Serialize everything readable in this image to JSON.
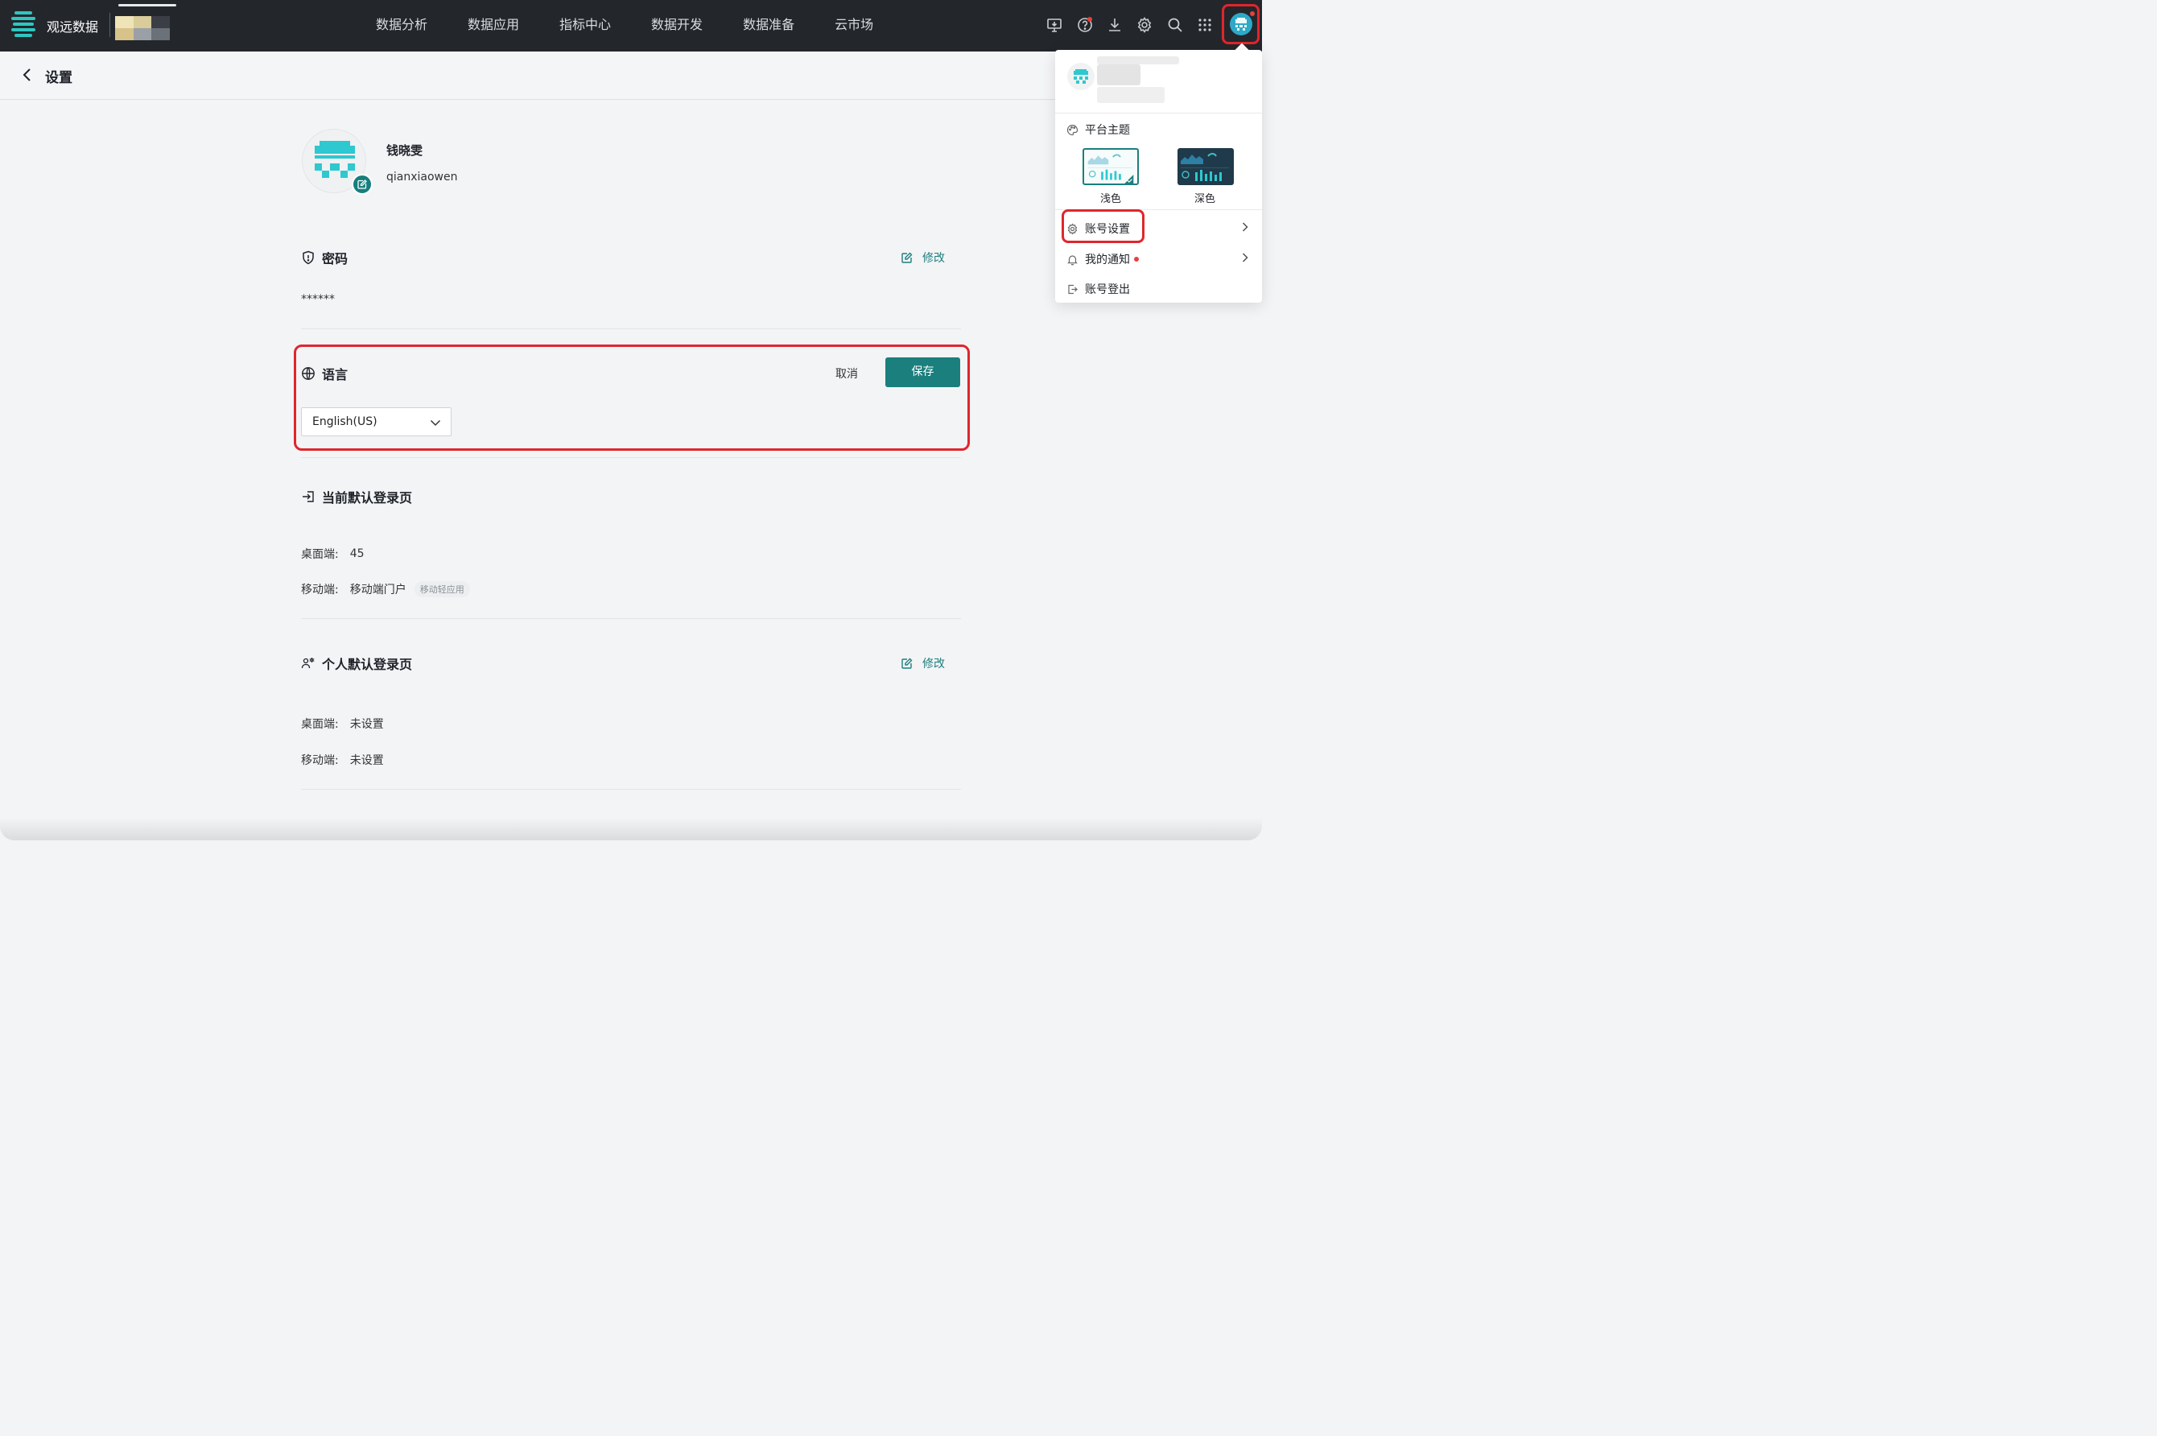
{
  "app": {
    "brand": "观远数据"
  },
  "nav": {
    "items": [
      "数据分析",
      "数据应用",
      "指标中心",
      "数据开发",
      "数据准备",
      "云市场"
    ]
  },
  "toolbar": {
    "icons": [
      "desktop-download-icon",
      "help-icon",
      "download-icon",
      "gear-icon",
      "search-icon",
      "apps-grid-icon"
    ]
  },
  "colors": {
    "topbar": "#23272c",
    "accent": "#1b7f7d",
    "highlight": "#e0262c",
    "badge": "#e8403c",
    "logo": "#2fc6c2"
  },
  "page": {
    "title": "设置"
  },
  "profile": {
    "name": "钱晓雯",
    "account": "qianxiaowen"
  },
  "password": {
    "title": "密码",
    "edit_label": "修改",
    "value": "******"
  },
  "language": {
    "title": "语言",
    "cancel_label": "取消",
    "save_label": "保存",
    "selected": "English(US)"
  },
  "current_login": {
    "title": "当前默认登录页",
    "desktop_label": "桌面端:",
    "desktop_value": "45",
    "mobile_label": "移动端:",
    "mobile_value": "移动端门户",
    "mobile_tag": "移动轻应用"
  },
  "personal_login": {
    "title": "个人默认登录页",
    "edit_label": "修改",
    "desktop_label": "桌面端:",
    "desktop_value": "未设置",
    "mobile_label": "移动端:",
    "mobile_value": "未设置"
  },
  "dropdown": {
    "theme_title": "平台主题",
    "themes": [
      "浅色",
      "深色"
    ],
    "selected_theme": "浅色",
    "account_settings": "账号设置",
    "notifications": "我的通知",
    "logout": "账号登出"
  }
}
